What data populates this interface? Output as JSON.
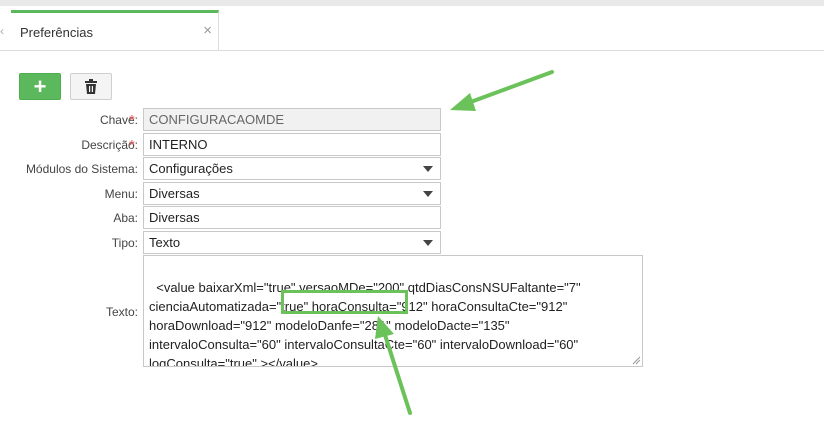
{
  "tabs": [
    {
      "label": "Preferências",
      "close": "×"
    }
  ],
  "toolbar": {
    "add_label": "+"
  },
  "form": {
    "chave": {
      "label": "Chave:",
      "required": "*",
      "value": "CONFIGURACAOMDE"
    },
    "descricao": {
      "label": "Descrição:",
      "required": "*",
      "value": "INTERNO"
    },
    "modulos": {
      "label": "Módulos do Sistema:",
      "value": "Configurações"
    },
    "menu": {
      "label": "Menu:",
      "value": "Diversas"
    },
    "aba": {
      "label": "Aba:",
      "value": "Diversas"
    },
    "tipo": {
      "label": "Tipo:",
      "value": "Texto"
    },
    "texto": {
      "label": "Texto:",
      "value": "<value baixarXml=\"true\" versaoMDe=\"200\" qtdDiasConsNSUFaltante=\"7\"\ncienciaAutomatizada=\"true\" horaConsulta=\"912\" horaConsultaCte=\"912\"\nhoraDownload=\"912\" modeloDanfe=\"281\" modeloDacte=\"135\"\nintervaloConsulta=\"60\" intervaloConsultaCte=\"60\" intervaloDownload=\"60\"\nlogConsulta=\"true\" ></value>"
    }
  },
  "colors": {
    "accent": "#5cb85c",
    "annotation": "#6cc25a",
    "required": "#d9534f"
  },
  "icons": {
    "add": "plus-icon",
    "delete": "trash-icon",
    "dropdown": "chevron-down-icon",
    "close": "close-icon"
  }
}
